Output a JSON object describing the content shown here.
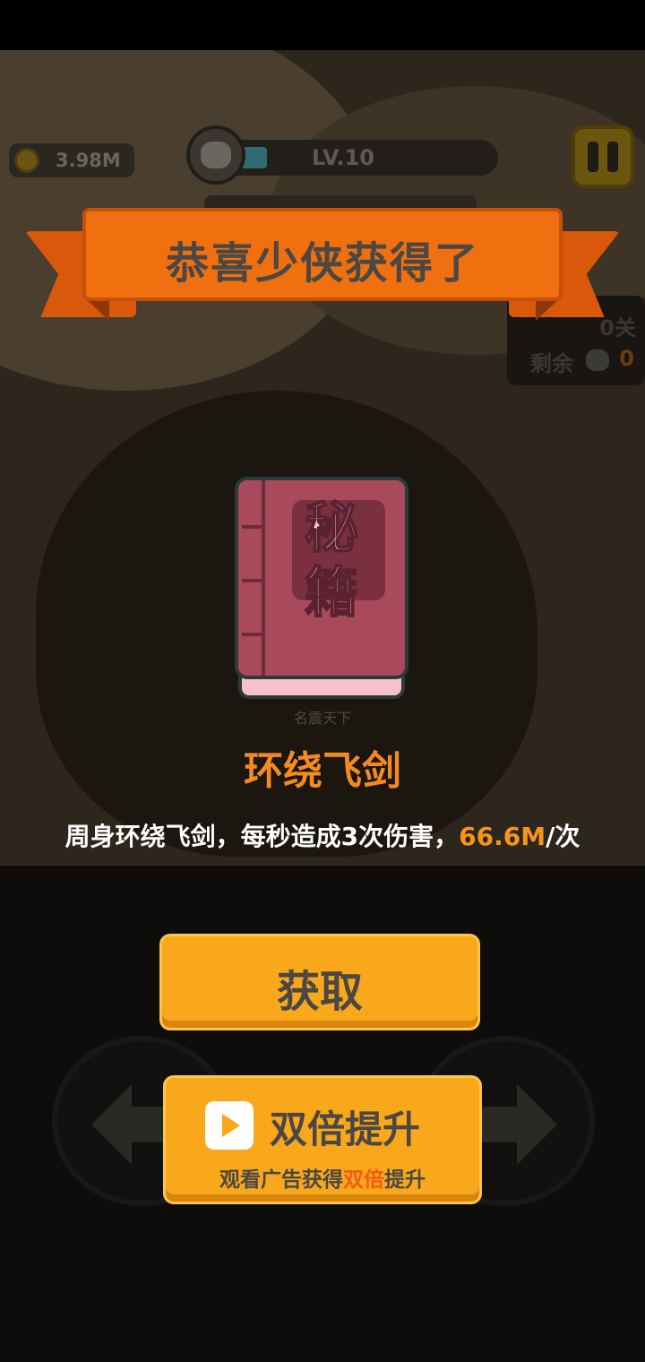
{
  "hud": {
    "coins": "3.98M",
    "level": "LV.10",
    "stage_partial": "0关",
    "remain_label": "剩余",
    "remain_count": "0"
  },
  "banner": {
    "title": "恭喜少侠获得了"
  },
  "reward": {
    "book_line1": "秘",
    "book_line2": "籍",
    "behind_badge": "名震天下",
    "name": "环绕飞剑",
    "desc_prefix": "周身环绕飞剑，每秒造成3次伤害，",
    "desc_value": "66.6M",
    "desc_suffix": "/次"
  },
  "buttons": {
    "claim_label": "获取",
    "double_label": "双倍提升",
    "double_sub_prefix": "观看广告获得",
    "double_sub_highlight": "双倍",
    "double_sub_suffix": "提升"
  },
  "icons": {
    "coin": "coin-icon",
    "pause": "pause-icon",
    "video": "play-video-icon",
    "left_arrow": "left-arrow-icon",
    "right_arrow": "right-arrow-icon"
  },
  "colors": {
    "banner": "#f07010",
    "button": "#f8a81a",
    "item_name": "#f58a1e",
    "highlight": "#f7941d",
    "double_highlight": "#f05a14"
  }
}
